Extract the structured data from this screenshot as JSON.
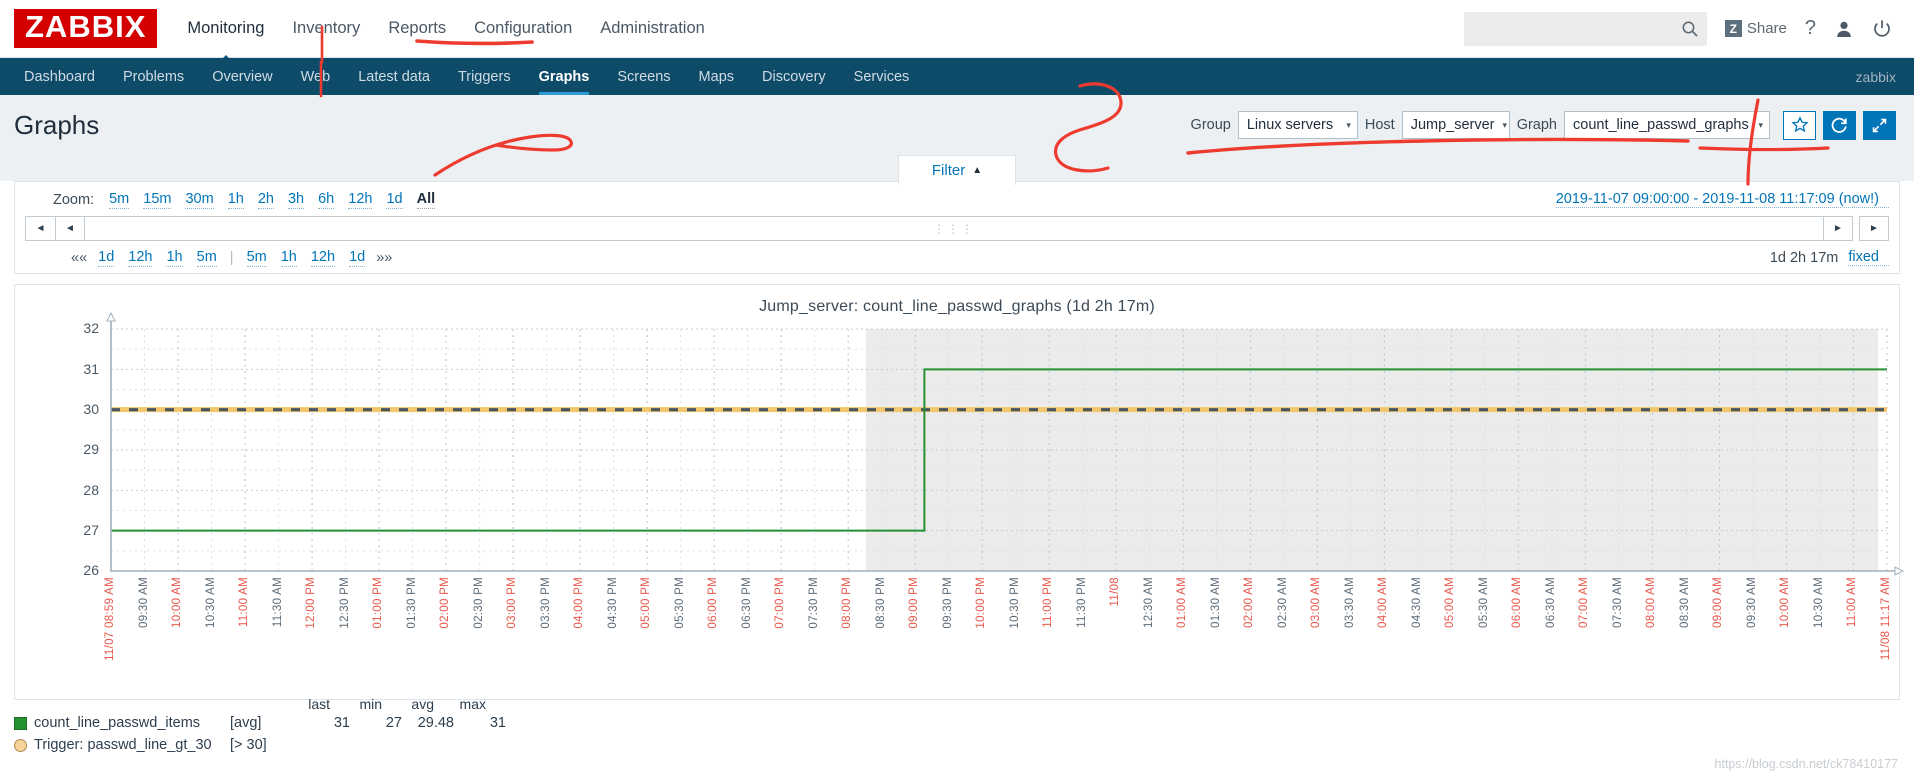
{
  "brand": {
    "logo": "ZABBIX"
  },
  "mainnav": {
    "items": [
      {
        "label": "Monitoring",
        "active": true
      },
      {
        "label": "Inventory",
        "active": false
      },
      {
        "label": "Reports",
        "active": false
      },
      {
        "label": "Configuration",
        "active": false
      },
      {
        "label": "Administration",
        "active": false
      }
    ]
  },
  "topright": {
    "search_value": "",
    "search_placeholder": "",
    "search_icon": "search-icon",
    "share_badge": "Z",
    "share_label": "Share",
    "help_label": "?",
    "user_icon": "user-icon",
    "power_icon": "power-icon"
  },
  "subnav": {
    "items": [
      {
        "label": "Dashboard",
        "active": false
      },
      {
        "label": "Problems",
        "active": false
      },
      {
        "label": "Overview",
        "active": false
      },
      {
        "label": "Web",
        "active": false
      },
      {
        "label": "Latest data",
        "active": false
      },
      {
        "label": "Triggers",
        "active": false
      },
      {
        "label": "Graphs",
        "active": true
      },
      {
        "label": "Screens",
        "active": false
      },
      {
        "label": "Maps",
        "active": false
      },
      {
        "label": "Discovery",
        "active": false
      },
      {
        "label": "Services",
        "active": false
      }
    ],
    "user": "zabbix"
  },
  "pagehead": {
    "title": "Graphs",
    "group_label": "Group",
    "group_value": "Linux servers",
    "host_label": "Host",
    "host_value": "Jump_server",
    "graph_label": "Graph",
    "graph_value": "count_line_passwd_graphs",
    "favorite_icon": "star-icon",
    "refresh_icon": "refresh-icon",
    "fullscreen_icon": "expand-icon",
    "caret": "▾"
  },
  "filter": {
    "label": "Filter",
    "collapse_icon": "▲"
  },
  "timecontrol": {
    "zoom_label": "Zoom:",
    "zoom_options": [
      {
        "label": "5m",
        "active": false
      },
      {
        "label": "15m",
        "active": false
      },
      {
        "label": "30m",
        "active": false
      },
      {
        "label": "1h",
        "active": false
      },
      {
        "label": "2h",
        "active": false
      },
      {
        "label": "3h",
        "active": false
      },
      {
        "label": "6h",
        "active": false
      },
      {
        "label": "12h",
        "active": false
      },
      {
        "label": "1d",
        "active": false
      },
      {
        "label": "All",
        "active": true
      }
    ],
    "range_text": "2019-11-07 09:00:00 - 2019-11-08 11:17:09 (now!)",
    "scroll_left_icon": "◄",
    "scroll_right_icon": "►",
    "grip": "⋮⋮⋮",
    "shortcuts_left": [
      "1d",
      "12h",
      "1h",
      "5m"
    ],
    "shortcuts_right": [
      "5m",
      "1h",
      "12h",
      "1d"
    ],
    "prev_chevrons": "««",
    "next_chevrons": "»»",
    "separator": "|",
    "duration": "1d 2h 17m",
    "fixed_label": "fixed"
  },
  "watermark": "https://blog.csdn.net/ck78410177",
  "chart_data": {
    "type": "line",
    "title": "Jump_server: count_line_passwd_graphs (1d 2h 17m)",
    "xlabel": "",
    "ylabel": "",
    "ylim": [
      26,
      32
    ],
    "yticks": [
      26,
      27,
      28,
      29,
      30,
      31,
      32
    ],
    "grid": true,
    "legend_position": "bottom-left",
    "x_start": "2019-11-07 08:59",
    "x_end": "2019-11-08 11:17",
    "xticks": [
      {
        "label": "11/07 08:59 AM",
        "hour": true
      },
      {
        "label": "09:30 AM",
        "hour": false
      },
      {
        "label": "10:00 AM",
        "hour": true
      },
      {
        "label": "10:30 AM",
        "hour": false
      },
      {
        "label": "11:00 AM",
        "hour": true
      },
      {
        "label": "11:30 AM",
        "hour": false
      },
      {
        "label": "12:00 PM",
        "hour": true
      },
      {
        "label": "12:30 PM",
        "hour": false
      },
      {
        "label": "01:00 PM",
        "hour": true
      },
      {
        "label": "01:30 PM",
        "hour": false
      },
      {
        "label": "02:00 PM",
        "hour": true
      },
      {
        "label": "02:30 PM",
        "hour": false
      },
      {
        "label": "03:00 PM",
        "hour": true
      },
      {
        "label": "03:30 PM",
        "hour": false
      },
      {
        "label": "04:00 PM",
        "hour": true
      },
      {
        "label": "04:30 PM",
        "hour": false
      },
      {
        "label": "05:00 PM",
        "hour": true
      },
      {
        "label": "05:30 PM",
        "hour": false
      },
      {
        "label": "06:00 PM",
        "hour": true
      },
      {
        "label": "06:30 PM",
        "hour": false
      },
      {
        "label": "07:00 PM",
        "hour": true
      },
      {
        "label": "07:30 PM",
        "hour": false
      },
      {
        "label": "08:00 PM",
        "hour": true
      },
      {
        "label": "08:30 PM",
        "hour": false
      },
      {
        "label": "09:00 PM",
        "hour": true
      },
      {
        "label": "09:30 PM",
        "hour": false
      },
      {
        "label": "10:00 PM",
        "hour": true
      },
      {
        "label": "10:30 PM",
        "hour": false
      },
      {
        "label": "11:00 PM",
        "hour": true
      },
      {
        "label": "11:30 PM",
        "hour": false
      },
      {
        "label": "11/08",
        "hour": true
      },
      {
        "label": "12:30 AM",
        "hour": false
      },
      {
        "label": "01:00 AM",
        "hour": true
      },
      {
        "label": "01:30 AM",
        "hour": false
      },
      {
        "label": "02:00 AM",
        "hour": true
      },
      {
        "label": "02:30 AM",
        "hour": false
      },
      {
        "label": "03:00 AM",
        "hour": true
      },
      {
        "label": "03:30 AM",
        "hour": false
      },
      {
        "label": "04:00 AM",
        "hour": true
      },
      {
        "label": "04:30 AM",
        "hour": false
      },
      {
        "label": "05:00 AM",
        "hour": true
      },
      {
        "label": "05:30 AM",
        "hour": false
      },
      {
        "label": "06:00 AM",
        "hour": true
      },
      {
        "label": "06:30 AM",
        "hour": false
      },
      {
        "label": "07:00 AM",
        "hour": true
      },
      {
        "label": "07:30 AM",
        "hour": false
      },
      {
        "label": "08:00 AM",
        "hour": true
      },
      {
        "label": "08:30 AM",
        "hour": false
      },
      {
        "label": "09:00 AM",
        "hour": true
      },
      {
        "label": "09:30 AM",
        "hour": false
      },
      {
        "label": "10:00 AM",
        "hour": true
      },
      {
        "label": "10:30 AM",
        "hour": false
      },
      {
        "label": "11:00 AM",
        "hour": true
      },
      {
        "label": "11/08 11:17 AM",
        "hour": true
      }
    ],
    "series": [
      {
        "name": "count_line_passwd_items",
        "color": "#259131",
        "style": "step",
        "aggregation": "[avg]",
        "points": [
          {
            "t": 0.0,
            "v": 27
          },
          {
            "t": 0.455,
            "v": 27
          },
          {
            "t": 0.458,
            "v": 31
          },
          {
            "t": 1.0,
            "v": 31
          }
        ],
        "stats": {
          "last": "31",
          "min": "27",
          "avg": "29.48",
          "max": "31"
        }
      }
    ],
    "threshold": {
      "name": "Trigger: passwd_line_gt_30",
      "expression": "[> 30]",
      "value": 30,
      "color": "#f2c66a"
    },
    "working_time": {
      "start": 0.425,
      "end": 0.995,
      "color": "#ebebeb"
    },
    "legend_headers": [
      "last",
      "min",
      "avg",
      "max"
    ]
  }
}
